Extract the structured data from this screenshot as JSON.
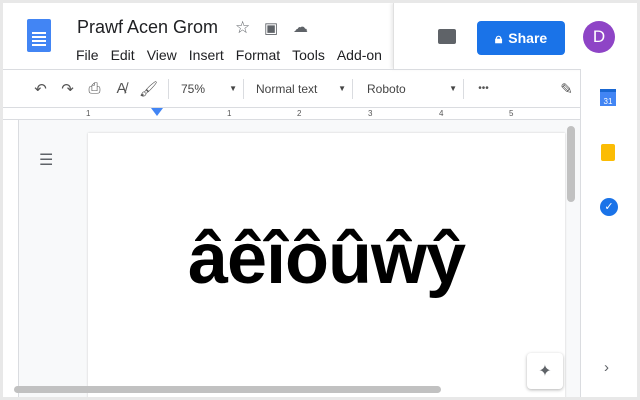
{
  "doc": {
    "title": "Prawf Acen Grom",
    "content": "âêîôûŵŷ"
  },
  "menu": [
    "File",
    "Edit",
    "View",
    "Insert",
    "Format",
    "Tools",
    "Add-on"
  ],
  "header": {
    "share_label": "Share",
    "avatar_initial": "D"
  },
  "toolbar": {
    "zoom": "75%",
    "style": "Normal text",
    "font": "Roboto",
    "more": "•••"
  },
  "ruler": {
    "labels": [
      "1",
      "1",
      "2",
      "3",
      "4",
      "5"
    ]
  },
  "sidebar": {
    "calendar_day": "31"
  },
  "colors": {
    "accent": "#1a73e8",
    "docs_blue": "#4285f4",
    "avatar": "#8e44c6"
  }
}
